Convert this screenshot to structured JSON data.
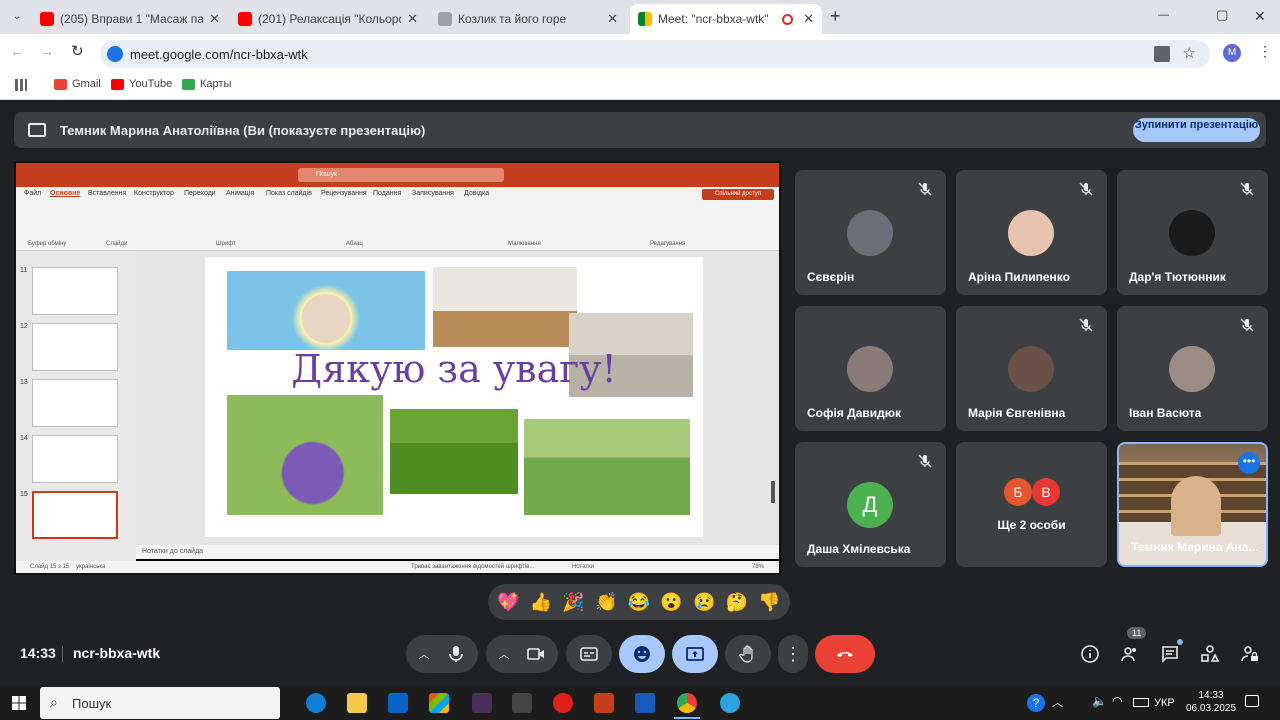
{
  "browser": {
    "tabs": [
      {
        "title": "(205) Вправи 1 \"Масаж пальчи",
        "favicon_color": "#ff0000",
        "close": "✕"
      },
      {
        "title": "(201) Релаксація \"Кольоротер",
        "favicon_color": "#ff0000",
        "close": "✕"
      },
      {
        "title": "Козлик та його горе",
        "favicon_color": "#9aa0a6",
        "close": "✕"
      },
      {
        "title": "Meet: \"ncr-bbxa-wtk\"",
        "favicon_color": "#00832d",
        "close": "✕"
      }
    ],
    "new_tab": "+",
    "window": {
      "minimize": "—",
      "maximize": "▢",
      "close": "✕"
    },
    "url": "meet.google.com/ncr-bbxa-wtk",
    "profile_letter": "M",
    "bookmarks": [
      {
        "label": "Gmail",
        "color": "#ea4335"
      },
      {
        "label": "YouTube",
        "color": "#ff0000"
      },
      {
        "label": "Карты",
        "color": "#34a853"
      }
    ]
  },
  "meet": {
    "banner_text": "Темник Марина Анатоліївна (Ви (показуєте презентацію)",
    "stop_button": "Зупинити презентацію",
    "meeting_time": "14:33",
    "meeting_code": "ncr-bbxa-wtk",
    "participants_count": "11",
    "participants": [
      {
        "name": "Сєвєрін",
        "muted": true,
        "avatar_color": "#6b6f7a"
      },
      {
        "name": "Аріна Пилипенко",
        "muted": true,
        "avatar_color": "#e7c3b0"
      },
      {
        "name": "Дар'я Тютюнник",
        "muted": true,
        "avatar_color": "#1a1a1a"
      },
      {
        "name": "Софія Давидюк",
        "muted": false,
        "avatar_color": "#8a7a78"
      },
      {
        "name": "Марія Євгенівна",
        "muted": true,
        "avatar_color": "#6b5147"
      },
      {
        "name": "Іван Васюта",
        "muted": true,
        "avatar_color": "#9b8c85"
      },
      {
        "name": "Даша Хмілевська",
        "muted": true,
        "avatar_letter": "Д",
        "avatar_color": "#4caf50"
      },
      {
        "name": "Ще 2 особи",
        "muted": false,
        "letters": [
          "Б",
          "В"
        ],
        "avatar_color": "#e4572e"
      },
      {
        "name": "Темник Марина Ана...",
        "muted": false,
        "active": true
      }
    ],
    "reactions": [
      "💖",
      "👍",
      "🎉",
      "👏",
      "😂",
      "😮",
      "😢",
      "🤔",
      "👎"
    ]
  },
  "presentation": {
    "search_placeholder": "Пошук",
    "share_button": "Спільний доступ",
    "ribbon_tabs": [
      "Файл",
      "Основне",
      "Вставлення",
      "Конструктор",
      "Переходи",
      "Анімація",
      "Показ слайдів",
      "Рецензування",
      "Подання",
      "Записування",
      "Довідка"
    ],
    "ribbon_groups": [
      "Буфер обміну",
      "Слайди",
      "Шрифт",
      "Абзац",
      "Малювання",
      "Редагування"
    ],
    "slide_numbers": [
      "11",
      "12",
      "13",
      "14",
      "15"
    ],
    "slide_title": "Дякую за увагу!",
    "notes_placeholder": "Нотатки до слайда",
    "status_left": "Слайд 15 з 15",
    "status_lang": "українська",
    "status_mid": "Триває завантаження відомостей шрифтів...",
    "status_notes": "Нотатки",
    "zoom": "78%"
  },
  "taskbar": {
    "search_label": "Пошук",
    "lang": "УКР",
    "time": "14:33",
    "date": "06.03.2025"
  }
}
